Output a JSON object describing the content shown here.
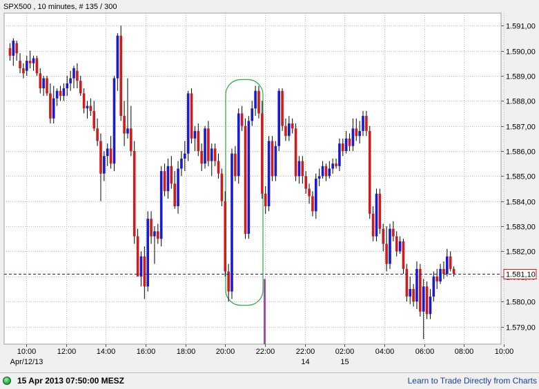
{
  "header": {
    "title": "SPX500 , 10 minutes, # 135 / 300"
  },
  "footer": {
    "timestamp": "15 Apr 2013 07:50:00 MESZ",
    "link": "Learn to Trade Directly from Charts",
    "status_icon": "green-status-dot"
  },
  "colors": {
    "up": "#1a1acf",
    "down": "#d01b1b",
    "current_line": "#1a1aa0",
    "highlight": "#33a84a",
    "marker": "#9b4fa8",
    "grid": "#b8b8b8"
  },
  "chart_data": {
    "type": "candlestick",
    "title": "SPX500 , 10 minutes, # 135 / 300",
    "ylim": [
      1578.3,
      1591.5
    ],
    "y_ticks": [
      1579,
      1580,
      1581,
      1582,
      1583,
      1584,
      1585,
      1586,
      1587,
      1588,
      1589,
      1590,
      1591
    ],
    "y_tick_labels": [
      "1.579,00",
      "1.580,00",
      "1.581,00",
      "1.582,00",
      "1.583,00",
      "1.584,00",
      "1.585,00",
      "1.586,00",
      "1.587,00",
      "1.588,00",
      "1.589,00",
      "1.590,00",
      "1.591,00"
    ],
    "x_ticks": [
      {
        "label": "10:00",
        "date": "Apr/12/13"
      },
      {
        "label": "12:00"
      },
      {
        "label": "14:00"
      },
      {
        "label": "16:00"
      },
      {
        "label": "18:00"
      },
      {
        "label": "20:00"
      },
      {
        "label": "22:00"
      },
      {
        "label": "22:00",
        "date": "14"
      },
      {
        "label": "02:00",
        "date": "15"
      },
      {
        "label": "04:00"
      },
      {
        "label": "06:00"
      },
      {
        "label": "08:00"
      },
      {
        "label": "10:00"
      }
    ],
    "last_price_label": "1.581,10",
    "last_price": 1581.1,
    "grid": true,
    "annotations": [
      "green ellipse around 20:00-22:00 session close",
      "purple vertical marker at session break"
    ],
    "candles": [
      {
        "o": 1590.1,
        "h": 1590.3,
        "l": 1589.6,
        "c": 1589.8
      },
      {
        "o": 1589.8,
        "h": 1590.5,
        "l": 1589.4,
        "c": 1590.4
      },
      {
        "o": 1590.3,
        "h": 1590.4,
        "l": 1589.6,
        "c": 1589.9
      },
      {
        "o": 1589.6,
        "h": 1589.9,
        "l": 1589.1,
        "c": 1589.3
      },
      {
        "o": 1589.3,
        "h": 1589.5,
        "l": 1588.9,
        "c": 1589.1
      },
      {
        "o": 1589.2,
        "h": 1589.8,
        "l": 1589.0,
        "c": 1589.6
      },
      {
        "o": 1589.6,
        "h": 1590.0,
        "l": 1589.3,
        "c": 1589.5
      },
      {
        "o": 1589.5,
        "h": 1589.8,
        "l": 1589.2,
        "c": 1589.7
      },
      {
        "o": 1589.7,
        "h": 1589.8,
        "l": 1589.0,
        "c": 1589.1
      },
      {
        "o": 1589.1,
        "h": 1589.3,
        "l": 1588.3,
        "c": 1588.5
      },
      {
        "o": 1588.5,
        "h": 1589.0,
        "l": 1588.2,
        "c": 1588.9
      },
      {
        "o": 1588.9,
        "h": 1589.0,
        "l": 1588.2,
        "c": 1588.3
      },
      {
        "o": 1588.3,
        "h": 1588.7,
        "l": 1587.1,
        "c": 1587.3
      },
      {
        "o": 1587.3,
        "h": 1588.6,
        "l": 1587.1,
        "c": 1588.1
      },
      {
        "o": 1588.1,
        "h": 1588.5,
        "l": 1587.8,
        "c": 1588.4
      },
      {
        "o": 1588.4,
        "h": 1588.6,
        "l": 1588.0,
        "c": 1588.2
      },
      {
        "o": 1588.2,
        "h": 1588.7,
        "l": 1588.0,
        "c": 1588.5
      },
      {
        "o": 1588.5,
        "h": 1589.0,
        "l": 1588.2,
        "c": 1588.7
      },
      {
        "o": 1588.7,
        "h": 1589.2,
        "l": 1588.4,
        "c": 1588.9
      },
      {
        "o": 1588.9,
        "h": 1589.4,
        "l": 1588.5,
        "c": 1589.3
      },
      {
        "o": 1589.2,
        "h": 1589.5,
        "l": 1588.5,
        "c": 1588.8
      },
      {
        "o": 1588.8,
        "h": 1589.0,
        "l": 1588.2,
        "c": 1588.3
      },
      {
        "o": 1588.3,
        "h": 1588.5,
        "l": 1587.5,
        "c": 1587.7
      },
      {
        "o": 1587.7,
        "h": 1588.0,
        "l": 1587.3,
        "c": 1587.8
      },
      {
        "o": 1587.8,
        "h": 1588.1,
        "l": 1587.4,
        "c": 1587.6
      },
      {
        "o": 1587.6,
        "h": 1588.0,
        "l": 1586.8,
        "c": 1586.9
      },
      {
        "o": 1586.9,
        "h": 1587.3,
        "l": 1586.2,
        "c": 1586.4
      },
      {
        "o": 1586.4,
        "h": 1586.7,
        "l": 1584.0,
        "c": 1585.1
      },
      {
        "o": 1585.1,
        "h": 1586.0,
        "l": 1584.8,
        "c": 1585.8
      },
      {
        "o": 1585.8,
        "h": 1586.3,
        "l": 1585.4,
        "c": 1586.1
      },
      {
        "o": 1586.1,
        "h": 1586.6,
        "l": 1585.3,
        "c": 1585.5
      },
      {
        "o": 1585.5,
        "h": 1589.0,
        "l": 1585.2,
        "c": 1588.9
      },
      {
        "o": 1588.9,
        "h": 1590.7,
        "l": 1588.4,
        "c": 1590.6
      },
      {
        "o": 1590.6,
        "h": 1591.0,
        "l": 1587.2,
        "c": 1587.4
      },
      {
        "o": 1587.4,
        "h": 1588.0,
        "l": 1586.2,
        "c": 1586.7
      },
      {
        "o": 1586.7,
        "h": 1588.9,
        "l": 1586.5,
        "c": 1586.9
      },
      {
        "o": 1586.9,
        "h": 1587.8,
        "l": 1585.8,
        "c": 1586.0
      },
      {
        "o": 1586.0,
        "h": 1586.4,
        "l": 1582.3,
        "c": 1582.6
      },
      {
        "o": 1582.6,
        "h": 1582.9,
        "l": 1581.8,
        "c": 1581.0
      },
      {
        "o": 1581.0,
        "h": 1582.0,
        "l": 1580.6,
        "c": 1581.8
      },
      {
        "o": 1581.8,
        "h": 1582.2,
        "l": 1580.1,
        "c": 1580.6
      },
      {
        "o": 1580.6,
        "h": 1583.6,
        "l": 1580.4,
        "c": 1583.3
      },
      {
        "o": 1583.3,
        "h": 1583.6,
        "l": 1582.3,
        "c": 1582.6
      },
      {
        "o": 1582.6,
        "h": 1583.0,
        "l": 1581.5,
        "c": 1582.8
      },
      {
        "o": 1582.8,
        "h": 1583.1,
        "l": 1582.3,
        "c": 1582.5
      },
      {
        "o": 1582.5,
        "h": 1585.4,
        "l": 1582.2,
        "c": 1585.2
      },
      {
        "o": 1585.2,
        "h": 1585.5,
        "l": 1584.2,
        "c": 1584.4
      },
      {
        "o": 1584.4,
        "h": 1585.7,
        "l": 1584.1,
        "c": 1585.4
      },
      {
        "o": 1585.4,
        "h": 1585.8,
        "l": 1584.5,
        "c": 1584.7
      },
      {
        "o": 1584.7,
        "h": 1585.2,
        "l": 1583.7,
        "c": 1583.8
      },
      {
        "o": 1583.8,
        "h": 1585.6,
        "l": 1583.5,
        "c": 1585.3
      },
      {
        "o": 1585.3,
        "h": 1586.0,
        "l": 1585.0,
        "c": 1585.7
      },
      {
        "o": 1585.7,
        "h": 1586.4,
        "l": 1585.2,
        "c": 1585.9
      },
      {
        "o": 1585.9,
        "h": 1588.4,
        "l": 1585.6,
        "c": 1588.3
      },
      {
        "o": 1588.3,
        "h": 1588.5,
        "l": 1586.3,
        "c": 1586.5
      },
      {
        "o": 1586.5,
        "h": 1587.0,
        "l": 1586.0,
        "c": 1586.8
      },
      {
        "o": 1586.8,
        "h": 1587.1,
        "l": 1585.8,
        "c": 1586.0
      },
      {
        "o": 1586.0,
        "h": 1586.3,
        "l": 1585.2,
        "c": 1585.5
      },
      {
        "o": 1585.5,
        "h": 1587.0,
        "l": 1585.3,
        "c": 1586.9
      },
      {
        "o": 1586.9,
        "h": 1587.2,
        "l": 1585.4,
        "c": 1585.6
      },
      {
        "o": 1585.6,
        "h": 1586.3,
        "l": 1585.0,
        "c": 1586.1
      },
      {
        "o": 1586.1,
        "h": 1586.3,
        "l": 1585.4,
        "c": 1585.6
      },
      {
        "o": 1585.6,
        "h": 1585.9,
        "l": 1584.9,
        "c": 1585.1
      },
      {
        "o": 1585.1,
        "h": 1585.3,
        "l": 1583.8,
        "c": 1584.0
      },
      {
        "o": 1584.0,
        "h": 1584.4,
        "l": 1581.0,
        "c": 1581.2
      },
      {
        "o": 1581.2,
        "h": 1581.5,
        "l": 1580.0,
        "c": 1580.4
      },
      {
        "o": 1580.4,
        "h": 1586.1,
        "l": 1580.1,
        "c": 1585.9
      },
      {
        "o": 1585.9,
        "h": 1586.2,
        "l": 1584.8,
        "c": 1585.0
      },
      {
        "o": 1585.0,
        "h": 1587.7,
        "l": 1584.7,
        "c": 1587.5
      },
      {
        "o": 1587.5,
        "h": 1587.8,
        "l": 1586.8,
        "c": 1587.0
      },
      {
        "o": 1587.0,
        "h": 1587.3,
        "l": 1582.5,
        "c": 1582.7
      },
      {
        "o": 1582.7,
        "h": 1587.4,
        "l": 1582.5,
        "c": 1587.2
      },
      {
        "o": 1587.2,
        "h": 1588.0,
        "l": 1587.0,
        "c": 1587.7
      },
      {
        "o": 1587.7,
        "h": 1588.6,
        "l": 1587.4,
        "c": 1588.4
      },
      {
        "o": 1588.4,
        "h": 1588.6,
        "l": 1587.3,
        "c": 1587.5
      },
      {
        "o": 1587.5,
        "h": 1588.0,
        "l": 1584.1,
        "c": 1584.3
      },
      {
        "o": 1584.3,
        "h": 1584.6,
        "l": 1583.5,
        "c": 1583.8
      },
      {
        "o": 1583.8,
        "h": 1586.6,
        "l": 1583.6,
        "c": 1586.4
      },
      {
        "o": 1586.4,
        "h": 1586.6,
        "l": 1584.8,
        "c": 1585.0
      },
      {
        "o": 1585.0,
        "h": 1586.4,
        "l": 1584.8,
        "c": 1586.2
      },
      {
        "o": 1586.2,
        "h": 1588.5,
        "l": 1586.0,
        "c": 1588.4
      },
      {
        "o": 1588.4,
        "h": 1588.5,
        "l": 1586.8,
        "c": 1587.0
      },
      {
        "o": 1587.0,
        "h": 1587.3,
        "l": 1586.4,
        "c": 1586.6
      },
      {
        "o": 1586.6,
        "h": 1587.4,
        "l": 1586.4,
        "c": 1587.1
      },
      {
        "o": 1587.1,
        "h": 1587.3,
        "l": 1586.7,
        "c": 1586.9
      },
      {
        "o": 1586.9,
        "h": 1587.1,
        "l": 1584.8,
        "c": 1585.0
      },
      {
        "o": 1585.0,
        "h": 1585.8,
        "l": 1584.7,
        "c": 1585.6
      },
      {
        "o": 1585.6,
        "h": 1585.8,
        "l": 1584.7,
        "c": 1585.0
      },
      {
        "o": 1585.0,
        "h": 1585.2,
        "l": 1584.3,
        "c": 1584.5
      },
      {
        "o": 1584.5,
        "h": 1584.7,
        "l": 1583.9,
        "c": 1584.2
      },
      {
        "o": 1584.2,
        "h": 1584.4,
        "l": 1583.4,
        "c": 1583.6
      },
      {
        "o": 1583.6,
        "h": 1585.1,
        "l": 1583.3,
        "c": 1584.9
      },
      {
        "o": 1584.9,
        "h": 1585.3,
        "l": 1584.6,
        "c": 1585.0
      },
      {
        "o": 1585.0,
        "h": 1585.6,
        "l": 1584.9,
        "c": 1585.4
      },
      {
        "o": 1585.4,
        "h": 1585.5,
        "l": 1584.8,
        "c": 1585.0
      },
      {
        "o": 1585.0,
        "h": 1585.6,
        "l": 1584.9,
        "c": 1585.3
      },
      {
        "o": 1585.3,
        "h": 1585.7,
        "l": 1585.1,
        "c": 1585.5
      },
      {
        "o": 1585.5,
        "h": 1585.7,
        "l": 1585.3,
        "c": 1585.4
      },
      {
        "o": 1585.4,
        "h": 1586.5,
        "l": 1585.2,
        "c": 1586.3
      },
      {
        "o": 1586.3,
        "h": 1586.5,
        "l": 1585.8,
        "c": 1586.0
      },
      {
        "o": 1586.0,
        "h": 1586.8,
        "l": 1585.9,
        "c": 1586.5
      },
      {
        "o": 1586.5,
        "h": 1586.7,
        "l": 1586.0,
        "c": 1586.2
      },
      {
        "o": 1586.2,
        "h": 1587.3,
        "l": 1586.0,
        "c": 1586.9
      },
      {
        "o": 1586.9,
        "h": 1587.3,
        "l": 1586.4,
        "c": 1586.6
      },
      {
        "o": 1586.6,
        "h": 1587.2,
        "l": 1586.3,
        "c": 1586.8
      },
      {
        "o": 1586.8,
        "h": 1587.6,
        "l": 1586.6,
        "c": 1587.4
      },
      {
        "o": 1587.4,
        "h": 1587.6,
        "l": 1586.6,
        "c": 1586.8
      },
      {
        "o": 1586.8,
        "h": 1587.0,
        "l": 1583.3,
        "c": 1583.5
      },
      {
        "o": 1583.5,
        "h": 1583.8,
        "l": 1582.4,
        "c": 1582.6
      },
      {
        "o": 1582.6,
        "h": 1584.5,
        "l": 1582.4,
        "c": 1584.3
      },
      {
        "o": 1584.3,
        "h": 1584.5,
        "l": 1582.7,
        "c": 1582.9
      },
      {
        "o": 1582.9,
        "h": 1583.1,
        "l": 1582.0,
        "c": 1582.3
      },
      {
        "o": 1582.3,
        "h": 1583.0,
        "l": 1581.2,
        "c": 1581.5
      },
      {
        "o": 1581.5,
        "h": 1583.1,
        "l": 1581.3,
        "c": 1582.9
      },
      {
        "o": 1582.9,
        "h": 1583.2,
        "l": 1582.4,
        "c": 1582.6
      },
      {
        "o": 1582.6,
        "h": 1582.8,
        "l": 1581.8,
        "c": 1582.0
      },
      {
        "o": 1582.0,
        "h": 1582.6,
        "l": 1581.9,
        "c": 1582.4
      },
      {
        "o": 1582.4,
        "h": 1582.5,
        "l": 1581.1,
        "c": 1581.3
      },
      {
        "o": 1581.3,
        "h": 1581.5,
        "l": 1580.0,
        "c": 1580.2
      },
      {
        "o": 1580.2,
        "h": 1581.0,
        "l": 1579.9,
        "c": 1580.5
      },
      {
        "o": 1580.5,
        "h": 1580.7,
        "l": 1579.8,
        "c": 1580.0
      },
      {
        "o": 1580.0,
        "h": 1581.6,
        "l": 1579.7,
        "c": 1581.3
      },
      {
        "o": 1581.3,
        "h": 1581.5,
        "l": 1579.4,
        "c": 1579.6
      },
      {
        "o": 1579.6,
        "h": 1580.9,
        "l": 1578.5,
        "c": 1580.6
      },
      {
        "o": 1580.6,
        "h": 1580.8,
        "l": 1579.3,
        "c": 1579.5
      },
      {
        "o": 1579.5,
        "h": 1580.5,
        "l": 1579.3,
        "c": 1580.2
      },
      {
        "o": 1580.2,
        "h": 1581.2,
        "l": 1580.0,
        "c": 1581.0
      },
      {
        "o": 1581.0,
        "h": 1581.3,
        "l": 1580.5,
        "c": 1580.8
      },
      {
        "o": 1580.8,
        "h": 1581.5,
        "l": 1580.7,
        "c": 1581.3
      },
      {
        "o": 1581.3,
        "h": 1581.6,
        "l": 1580.9,
        "c": 1581.1
      },
      {
        "o": 1581.1,
        "h": 1582.1,
        "l": 1581.0,
        "c": 1581.8
      },
      {
        "o": 1581.8,
        "h": 1582.0,
        "l": 1581.2,
        "c": 1581.3
      },
      {
        "o": 1581.3,
        "h": 1581.4,
        "l": 1581.0,
        "c": 1581.1
      }
    ]
  }
}
